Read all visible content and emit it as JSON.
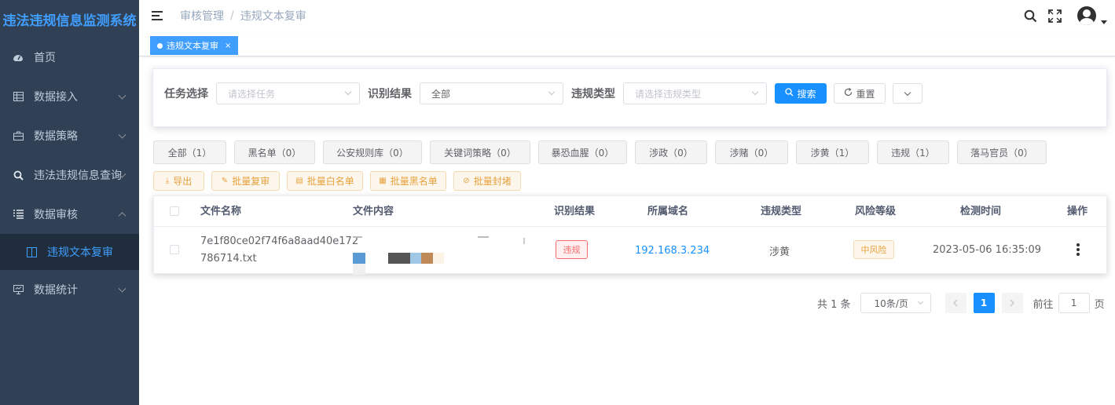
{
  "app": {
    "title": "违法违规信息监测系统"
  },
  "sidebar": {
    "items": [
      {
        "label": "首页",
        "icon": "dashboard-icon"
      },
      {
        "label": "数据接入",
        "icon": "table-icon"
      },
      {
        "label": "数据策略",
        "icon": "briefcase-icon"
      },
      {
        "label": "违法违规信息查询",
        "icon": "search-icon"
      },
      {
        "label": "数据审核",
        "icon": "list-icon"
      },
      {
        "label": "违规文本复审",
        "icon": "document-icon"
      },
      {
        "label": "数据统计",
        "icon": "monitor-icon"
      }
    ]
  },
  "breadcrumb": {
    "parent": "审核管理",
    "sep": "/",
    "current": "违规文本复审"
  },
  "tags": {
    "active": "违规文本复审",
    "close": "×"
  },
  "search": {
    "task_label": "任务选择",
    "task_placeholder": "请选择任务",
    "result_label": "识别结果",
    "result_value": "全部",
    "type_label": "违规类型",
    "type_placeholder": "请选择违规类型",
    "search_btn": "搜索",
    "reset_btn": "重置"
  },
  "chips": [
    "全部（1）",
    "黑名单（0）",
    "公安规则库（0）",
    "关键词策略（0）",
    "暴恐血腥（0）",
    "涉政（0）",
    "涉赌（0）",
    "涉黄（1）",
    "违规（1）",
    "落马官员（0）"
  ],
  "actions": [
    "导出",
    "批量复审",
    "批量白名单",
    "批量黑名单",
    "批量封堵"
  ],
  "table": {
    "headers": [
      "文件名称",
      "文件内容",
      "识别结果",
      "所属域名",
      "违规类型",
      "风险等级",
      "检测时间",
      "操作"
    ],
    "rows": [
      {
        "file_name_line1": "7e1f80ce02f74f6a8aad40e172",
        "file_name_line2": "786714.txt",
        "result": "违规",
        "domain": "192.168.3.234",
        "type": "涉黄",
        "risk": "中风险",
        "time": "2023-05-06 16:35:09"
      }
    ]
  },
  "pagination": {
    "total": "共 1 条",
    "page_size": "10条/页",
    "current": "1",
    "goto_label": "前往",
    "goto_value": "1",
    "page_unit": "页"
  },
  "colors": {
    "primary": "#1890ff",
    "sidebar_bg": "#304156",
    "warning": "#e6a23c",
    "danger": "#f56c6c"
  }
}
